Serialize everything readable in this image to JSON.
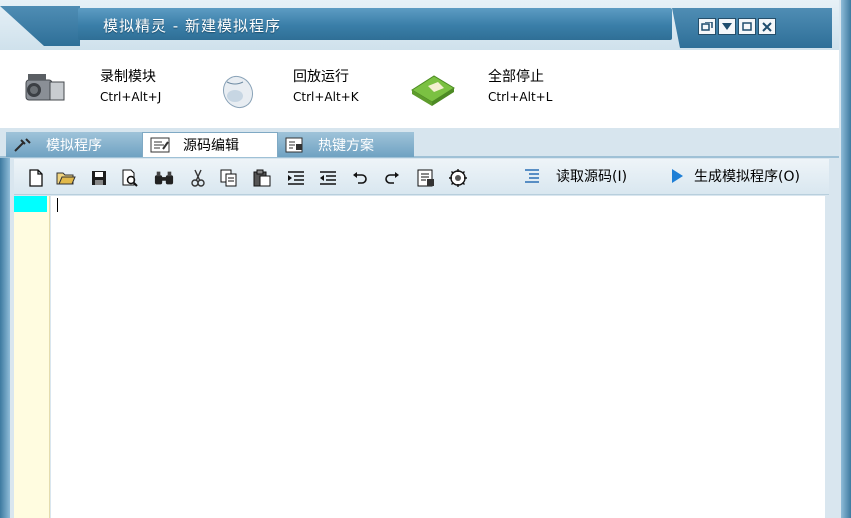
{
  "window": {
    "title": "模拟精灵 - 新建模拟程序",
    "controls": [
      "restore",
      "minimize",
      "maximize",
      "close"
    ]
  },
  "big_toolbar": [
    {
      "label": "录制模块",
      "shortcut": "Ctrl+Alt+J",
      "icon": "camcorder-icon"
    },
    {
      "label": "回放运行",
      "shortcut": "Ctrl+Alt+K",
      "icon": "mouse-icon"
    },
    {
      "label": "全部停止",
      "shortcut": "Ctrl+Alt+L",
      "icon": "green-card-icon"
    }
  ],
  "tabs": [
    {
      "label": "模拟程序",
      "icon": "wrench-icon",
      "active": false
    },
    {
      "label": "源码编辑",
      "icon": "code-edit-icon",
      "active": true
    },
    {
      "label": "热键方案",
      "icon": "hotkey-icon",
      "active": false
    }
  ],
  "editor_toolbar": {
    "icons": [
      "new-file-icon",
      "open-folder-icon",
      "save-icon",
      "print-preview-icon",
      "find-icon",
      "cut-icon",
      "copy-icon",
      "paste-icon",
      "indent-icon",
      "outdent-icon",
      "undo-icon",
      "redo-icon",
      "grid-icon",
      "settings-icon"
    ],
    "read_source_label": "读取源码(I)",
    "generate_label": "生成模拟程序(O)"
  },
  "colors": {
    "title_bar": "#3a7ea8",
    "gutter": "#fffce0",
    "current_line": "#00ffff",
    "play_arrow": "#1e7fd6"
  }
}
